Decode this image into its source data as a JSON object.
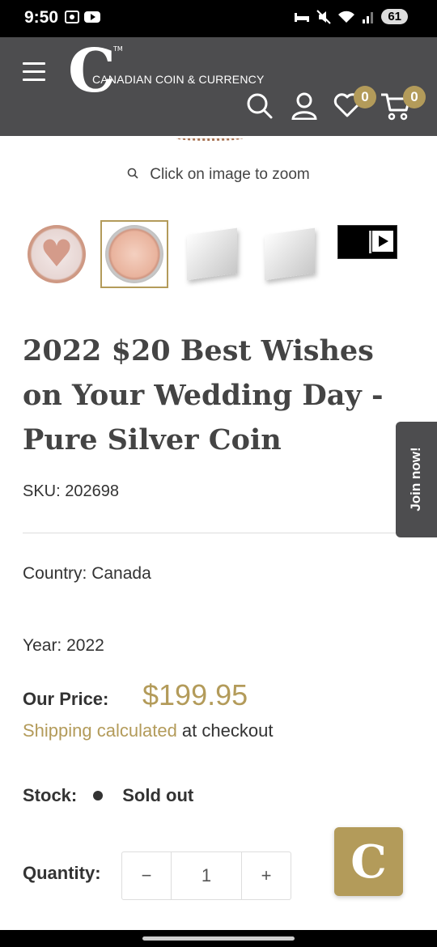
{
  "status_bar": {
    "time": "9:50",
    "battery": "61"
  },
  "header": {
    "logo_letter": "C",
    "logo_text": "CANADIAN COIN & CURRENCY",
    "logo_tm": "TM",
    "wishlist_count": "0",
    "cart_count": "0"
  },
  "gallery": {
    "zoom_hint": "Click on image to zoom"
  },
  "product": {
    "title": "2022 $20 Best Wishes on Your Wedding Day - Pure Silver Coin",
    "sku": "SKU: 202698",
    "country": "Country: Canada",
    "year": "Year: 2022",
    "price_label": "Our Price:",
    "price": "$199.95",
    "shipping_link": "Shipping calculated",
    "shipping_rest": " at checkout",
    "stock_label": "Stock:",
    "stock_status": "Sold out",
    "quantity_label": "Quantity:",
    "quantity_value": "1",
    "minus": "−",
    "plus": "+"
  },
  "join_tab": "Join now!",
  "chat_button_letter": "C",
  "colors": {
    "accent": "#b39b5a",
    "header_bg": "#4d4d4f"
  }
}
